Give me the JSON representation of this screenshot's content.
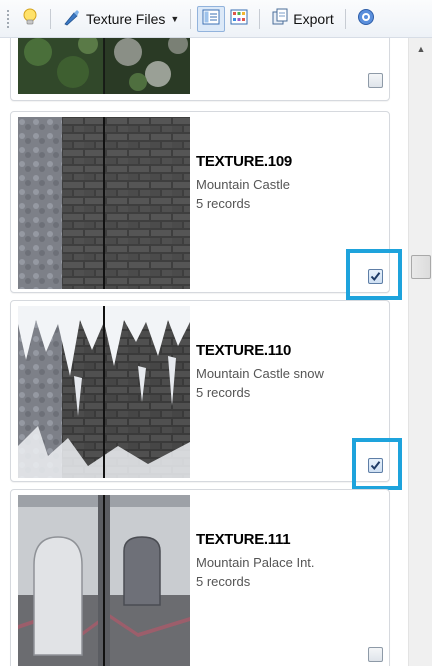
{
  "toolbar": {
    "texture_files_label": "Texture Files",
    "export_label": "Export",
    "icons": [
      "lightbulb-icon",
      "brush-icon",
      "view-details-icon",
      "view-thumbnails-icon",
      "export-icon",
      "help-icon"
    ]
  },
  "items": [
    {
      "title": "",
      "subtitle": "",
      "records": "",
      "checked": false
    },
    {
      "title": "TEXTURE.109",
      "subtitle": "Mountain Castle",
      "records": "5 records",
      "checked": true,
      "highlighted": true
    },
    {
      "title": "TEXTURE.110",
      "subtitle": "Mountain Castle snow",
      "records": "5 records",
      "checked": true,
      "highlighted": true
    },
    {
      "title": "TEXTURE.111",
      "subtitle": "Mountain Palace Int.",
      "records": "5 records",
      "checked": false
    }
  ],
  "colors": {
    "highlight": "#1ea3dc",
    "toolbar_active": "#dce9f8",
    "card_border": "#d6d9de"
  }
}
